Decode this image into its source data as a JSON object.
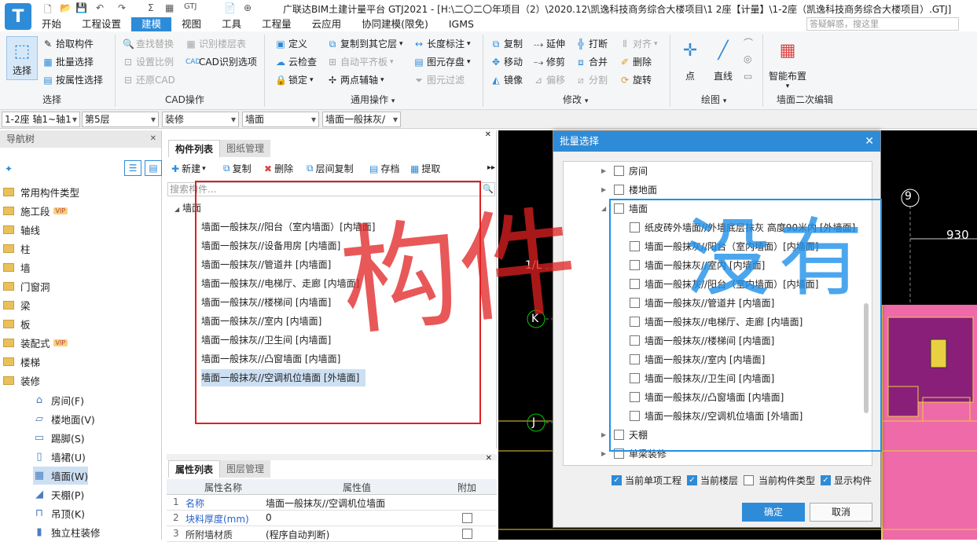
{
  "app": {
    "title": "广联达BIM土建计量平台 GTJ2021 - [H:\\二〇二〇年项目（2）\\2020.12\\凯逸科技商务综合大楼项目\\1 2座【计量】\\1-2座（凯逸科技商务综合大楼项目）.GTJ]",
    "logo_letter": "T",
    "help_search_placeholder": "答疑解惑，搜这里"
  },
  "menu": [
    "开始",
    "工程设置",
    "建模",
    "视图",
    "工具",
    "工程量",
    "云应用",
    "协同建模(限免)",
    "IGMS"
  ],
  "ribbon": {
    "select": {
      "big": "选择",
      "items": [
        "拾取构件",
        "批量选择",
        "按属性选择"
      ],
      "group": "选择"
    },
    "cad": {
      "items": [
        "查找替换",
        "设置比例",
        "还原CAD",
        "识别楼层表",
        "CAD识别选项"
      ],
      "group": "CAD操作"
    },
    "common": {
      "items": [
        "定义",
        "云检查",
        "锁定",
        "复制到其它层",
        "自动平齐板",
        "两点辅轴",
        "长度标注",
        "图元存盘",
        "图元过滤"
      ],
      "group": "通用操作"
    },
    "modify": {
      "items": [
        "复制",
        "移动",
        "镜像",
        "延伸",
        "修剪",
        "偏移",
        "打断",
        "合并",
        "分割",
        "对齐",
        "删除",
        "旋转"
      ],
      "group": "修改"
    },
    "draw": {
      "items": [
        "点",
        "直线"
      ],
      "group": "绘图"
    },
    "smart": {
      "big": "智能布置",
      "group": "墙面二次编辑"
    }
  },
  "selectors": [
    "1-2座 轴1~轴1",
    "第5层",
    "装修",
    "墙面",
    "墙面一般抹灰/"
  ],
  "nav": {
    "title": "导航树",
    "items": [
      {
        "label": "常用构件类型",
        "vip": false
      },
      {
        "label": "施工段",
        "vip": true
      },
      {
        "label": "轴线",
        "vip": false
      },
      {
        "label": "柱",
        "vip": false
      },
      {
        "label": "墙",
        "vip": false
      },
      {
        "label": "门窗洞",
        "vip": false
      },
      {
        "label": "梁",
        "vip": false
      },
      {
        "label": "板",
        "vip": false
      },
      {
        "label": "装配式",
        "vip": true
      },
      {
        "label": "楼梯",
        "vip": false
      },
      {
        "label": "装修",
        "vip": false
      }
    ],
    "vip_label": "VIP",
    "sub": [
      "房间(F)",
      "楼地面(V)",
      "踢脚(S)",
      "墙裙(U)",
      "墙面(W)",
      "天棚(P)",
      "吊顶(K)",
      "独立柱装修"
    ]
  },
  "components": {
    "tabs": [
      "构件列表",
      "图纸管理"
    ],
    "toolbar": [
      "新建",
      "复制",
      "删除",
      "层间复制",
      "存档",
      "提取"
    ],
    "search_placeholder": "搜索构件...",
    "group": "墙面",
    "items": [
      "墙面一般抹灰//阳台（室内墙面）[内墙面]",
      "墙面一般抹灰//设备用房 [内墙面]",
      "墙面一般抹灰//管道井 [内墙面]",
      "墙面一般抹灰//电梯厅、走廊 [内墙面]",
      "墙面一般抹灰//楼梯间 [内墙面]",
      "墙面一般抹灰//室内 [内墙面]",
      "墙面一般抹灰//卫生间 [内墙面]",
      "墙面一般抹灰//凸窗墙面 [内墙面]",
      "墙面一般抹灰//空调机位墙面 [外墙面]"
    ]
  },
  "properties": {
    "tabs": [
      "属性列表",
      "图层管理"
    ],
    "headers": [
      "属性名称",
      "属性值",
      "附加"
    ],
    "rows": [
      {
        "no": "1",
        "name": "名称",
        "value": "墙面一般抹灰//空调机位墙面"
      },
      {
        "no": "2",
        "name": "块料厚度(mm)",
        "value": "0"
      },
      {
        "no": "3",
        "name": "所附墙材质",
        "value": "(程序自动判断)"
      }
    ]
  },
  "canvas": {
    "axis_labels": [
      "9",
      "1/L",
      "K",
      "J"
    ],
    "dim_text": "930"
  },
  "dialog": {
    "title": "批量选择",
    "tree": {
      "top": [
        "房间",
        "楼地面"
      ],
      "group": "墙面",
      "items": [
        "纸皮砖外墙面//外墙底层抹灰 高度90米内 [外墙面]",
        "墙面一般抹灰//阳台（室内墙面）[内墙面]",
        "墙面一般抹灰//室内 [内墙面]",
        "墙面一般抹灰//阳台（室内墙面）[内墙面]",
        "墙面一般抹灰//管道井 [内墙面]",
        "墙面一般抹灰//电梯厅、走廊 [内墙面]",
        "墙面一般抹灰//楼梯间 [内墙面]",
        "墙面一般抹灰//室内 [内墙面]",
        "墙面一般抹灰//卫生间 [内墙面]",
        "墙面一般抹灰//凸窗墙面 [内墙面]",
        "墙面一般抹灰//空调机位墙面 [外墙面]"
      ],
      "bottom": [
        "天棚",
        "单梁装修"
      ]
    },
    "options": [
      {
        "label": "当前单项工程",
        "checked": true
      },
      {
        "label": "当前楼层",
        "checked": true
      },
      {
        "label": "当前构件类型",
        "checked": false
      },
      {
        "label": "显示构件",
        "checked": true
      }
    ],
    "ok": "确定",
    "cancel": "取消"
  },
  "annotations": {
    "red_text": "构件",
    "blue_text": "没有"
  }
}
